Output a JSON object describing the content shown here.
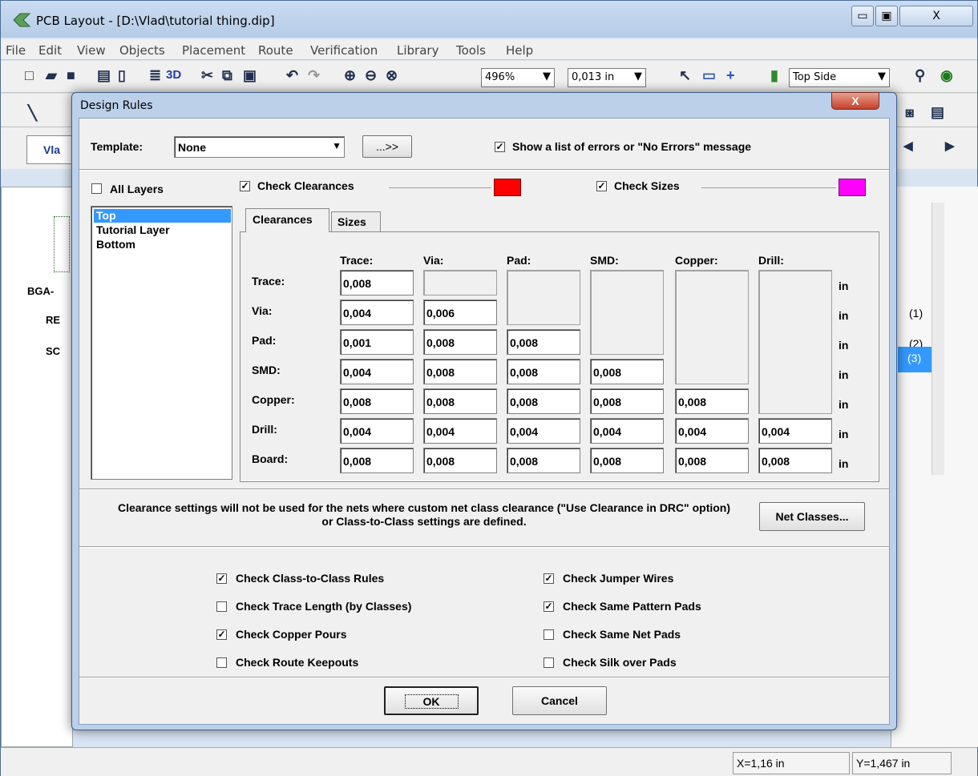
{
  "app": {
    "title": "PCB Layout - [D:\\Vlad\\tutorial thing.dip]",
    "caption_buttons": [
      "▭",
      "▣",
      "X"
    ],
    "menu": [
      "File",
      "Edit",
      "View",
      "Objects",
      "Placement",
      "Route",
      "Verification",
      "Library",
      "Tools",
      "Help"
    ],
    "toolbar": {
      "three_d_label": "3D",
      "zoom": "496%",
      "grid": "0,013 in",
      "side": "Top Side"
    },
    "left_panel": {
      "tab_label": "Vla",
      "items": [
        "BGA-",
        "RE",
        "SC"
      ]
    },
    "right_panel": {
      "items": [
        "(1)",
        "(2)",
        "(3)"
      ]
    },
    "status": {
      "x": "X=1,16 in",
      "y": "Y=1,467 in"
    }
  },
  "dialog": {
    "title": "Design Rules",
    "close_label": "X",
    "template_label": "Template:",
    "template_value": "None",
    "browse_label": "...>>",
    "show_errors_label": "Show a list of errors or \"No Errors\" message",
    "show_errors_checked": true,
    "all_layers_label": "All Layers",
    "all_layers_checked": false,
    "check_clearances_label": "Check Clearances",
    "check_clearances_checked": true,
    "clearance_color": "#ff0000",
    "check_sizes_label": "Check Sizes",
    "check_sizes_checked": true,
    "sizes_color": "#ff00ff",
    "layers": [
      "Top",
      "Tutorial Layer",
      "Bottom"
    ],
    "selected_layer": "Top",
    "tabs": [
      "Clearances",
      "Sizes"
    ],
    "active_tab": "Clearances",
    "columns": [
      "Trace:",
      "Via:",
      "Pad:",
      "SMD:",
      "Copper:",
      "Drill:"
    ],
    "rows": [
      "Trace:",
      "Via:",
      "Pad:",
      "SMD:",
      "Copper:",
      "Drill:",
      "Board:"
    ],
    "matrix": [
      [
        "0,008",
        "",
        null,
        null,
        null,
        null
      ],
      [
        "0,004",
        "0,006",
        null,
        null,
        null,
        null
      ],
      [
        "0,001",
        "0,008",
        "0,008",
        null,
        null,
        null
      ],
      [
        "0,004",
        "0,008",
        "0,008",
        "0,008",
        null,
        null
      ],
      [
        "0,008",
        "0,008",
        "0,008",
        "0,008",
        "0,008",
        null
      ],
      [
        "0,004",
        "0,004",
        "0,004",
        "0,004",
        "0,004",
        "0,004"
      ],
      [
        "0,008",
        "0,008",
        "0,008",
        "0,008",
        "0,008",
        "0,008"
      ]
    ],
    "unit": "in",
    "note": "Clearance settings will not be used for the nets where custom net class clearance (\"Use Clearance in DRC\" option) or Class-to-Class settings are defined.",
    "net_classes_label": "Net Classes...",
    "options": [
      {
        "label": "Check Class-to-Class Rules",
        "checked": true
      },
      {
        "label": "Check Trace Length (by Classes)",
        "checked": false
      },
      {
        "label": "Check Copper Pours",
        "checked": true
      },
      {
        "label": "Check Route Keepouts",
        "checked": false
      },
      {
        "label": "Check Jumper Wires",
        "checked": true
      },
      {
        "label": "Check Same Pattern Pads",
        "checked": true
      },
      {
        "label": "Check Same Net Pads",
        "checked": false
      },
      {
        "label": "Check Silk over Pads",
        "checked": false
      }
    ],
    "ok_label": "OK",
    "cancel_label": "Cancel"
  }
}
